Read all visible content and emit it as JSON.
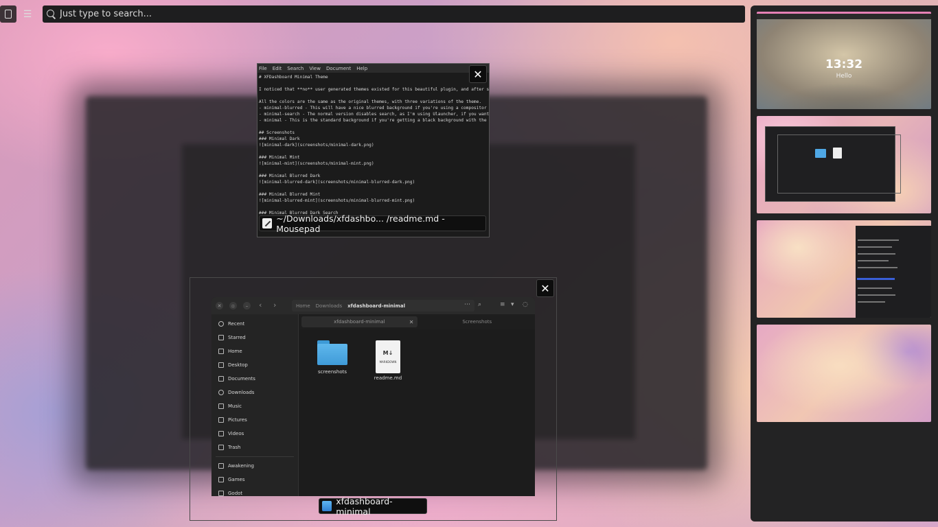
{
  "search": {
    "placeholder": "Just type to search..."
  },
  "workspaces": {
    "clock": "13:32",
    "greeting": "Hello"
  },
  "mousepad": {
    "menu": [
      "File",
      "Edit",
      "Search",
      "View",
      "Document",
      "Help"
    ],
    "text": "# XFDashboard Minimal Theme\n\nI noticed that **no** user generated themes existed for this beautiful plugin, and after st\n\nAll the colors are the same as the original themes, with three variations of the theme.\n- minimal-blurred - This will have a nice blurred background if you're using a compositor (\n- minimal-search - The normal version disables search, as I'm using Ulauncher, if you want\n- minimal - This is the standard background if you're getting a black background with the b\n\n## Screenshots\n### Minimal Dark\n![minimal-dark](screenshots/minimal-dark.png)\n\n### Minimal Mint\n![minimal-mint](screenshots/minimal-mint.png)\n\n### Minimal Blurred Dark\n![minimal-blurred-dark](screenshots/minimal-blurred-dark.png)\n\n### Minimal Blurred Mint\n![minimal-blurred-mint](screenshots/minimal-blurred-mint.png)\n\n### Minimal Blurred Dark Search",
    "caption": "~/Downloads/xfdashbo... /readme.md - Mousepad",
    "close": "✕"
  },
  "filemanager": {
    "path": {
      "home": "Home",
      "downloads": "Downloads",
      "current": "xfdashboard-minimal"
    },
    "sidebar": [
      "Recent",
      "Starred",
      "Home",
      "Desktop",
      "Documents",
      "Downloads",
      "Music",
      "Pictures",
      "Videos",
      "Trash"
    ],
    "bookmarks": [
      "Awakening",
      "Games",
      "Godot"
    ],
    "tabs": [
      "xfdashboard-minimal",
      "Screenshots"
    ],
    "tab_close": "✕",
    "files": [
      {
        "name": "screenshots",
        "type": "folder"
      },
      {
        "name": "readme.md",
        "type": "markdown",
        "badge": "M↓",
        "sub": "MARKDOWN"
      }
    ],
    "caption": "xfdashboard-minimal",
    "close": "✕"
  }
}
